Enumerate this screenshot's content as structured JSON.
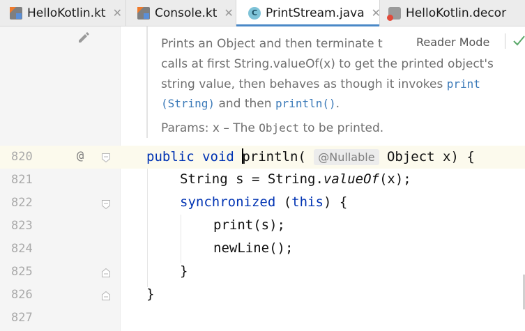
{
  "tabs": [
    {
      "label": "HelloKotlin.kt",
      "icon": "kotlin-file-icon",
      "active": false,
      "closable": true
    },
    {
      "label": "Console.kt",
      "icon": "kotlin-file-icon",
      "active": false,
      "closable": true
    },
    {
      "label": "PrintStream.java",
      "icon": "java-class-icon",
      "active": true,
      "closable": true
    },
    {
      "label": "HelloKotlin.decor",
      "icon": "decompiled-file-icon",
      "active": false,
      "closable": false
    }
  ],
  "close_glyph": "✕",
  "class_icon_letter": "C",
  "reader": {
    "mode_label": "Reader Mode",
    "doc_line1": "Prints an Object and then terminate t",
    "doc_line2": "calls at first String.valueOf(x) to get the printed object's",
    "doc_line3_pre": "string value, then behaves as though it invokes ",
    "doc_line3_link": "print",
    "doc_line4_link": "(String)",
    "doc_line4_mid": " and then ",
    "doc_line4_link2": "println()",
    "doc_line4_post": ".",
    "params_pre": "Params: x – The ",
    "params_code": "Object",
    "params_post": " to be printed."
  },
  "gutter": {
    "lines": [
      "820",
      "821",
      "822",
      "823",
      "824",
      "825",
      "826",
      "827"
    ],
    "override_marker": "@"
  },
  "code": {
    "line820": {
      "kw1": "public",
      "kw2": "void",
      "method": "println(",
      "annotation": "@Nullable",
      "rest": "Object x) {"
    },
    "line821": {
      "pre": "String s = String.",
      "call": "valueOf",
      "post": "(x);"
    },
    "line822": {
      "kw": "synchronized",
      "mid": " (",
      "kw2": "this",
      "post": ") {"
    },
    "line823": "print(s);",
    "line824": "newLine();",
    "line825": "}",
    "line826": "}"
  },
  "colors": {
    "keyword": "#0033b3",
    "link": "#3a79b8",
    "active_tab_underline": "#4a88c7",
    "caret_line": "#fcfaed"
  }
}
